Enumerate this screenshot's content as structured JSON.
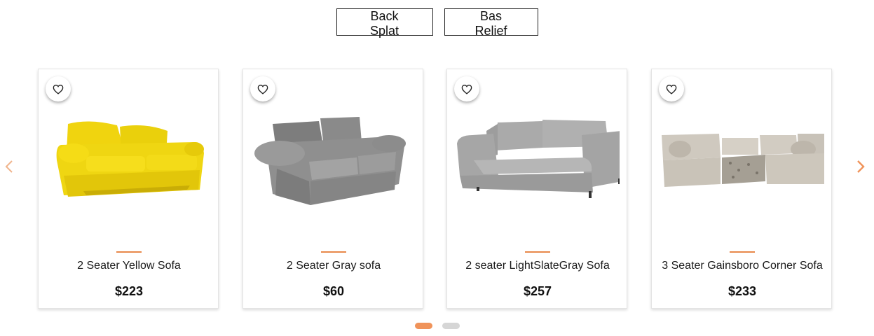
{
  "tabs": [
    {
      "label": "Back Splat"
    },
    {
      "label": "Bas Relief"
    }
  ],
  "carousel": {
    "prev_icon": "chevron-left-icon",
    "next_icon": "chevron-right-icon",
    "arrow_color": "#f0935a",
    "products": [
      {
        "name": "2 Seater Yellow Sofa",
        "price": "$223",
        "color": "#f2d91a",
        "image": "yellow-two-seater-sofa"
      },
      {
        "name": "2 Seater Gray sofa",
        "price": "$60",
        "color": "#8a8a8a",
        "image": "gray-two-seater-sofa"
      },
      {
        "name": "2 seater LightSlateGray Sofa",
        "price": "$257",
        "color": "#a9a9a9",
        "image": "light-slate-gray-sofa-bed"
      },
      {
        "name": "3 Seater Gainsboro Corner Sofa",
        "price": "$233",
        "color": "#d8d2c8",
        "image": "gainsboro-corner-sofa"
      }
    ],
    "pagination": {
      "pages": 2,
      "active": 1
    },
    "accent_color": "#e8884a"
  }
}
